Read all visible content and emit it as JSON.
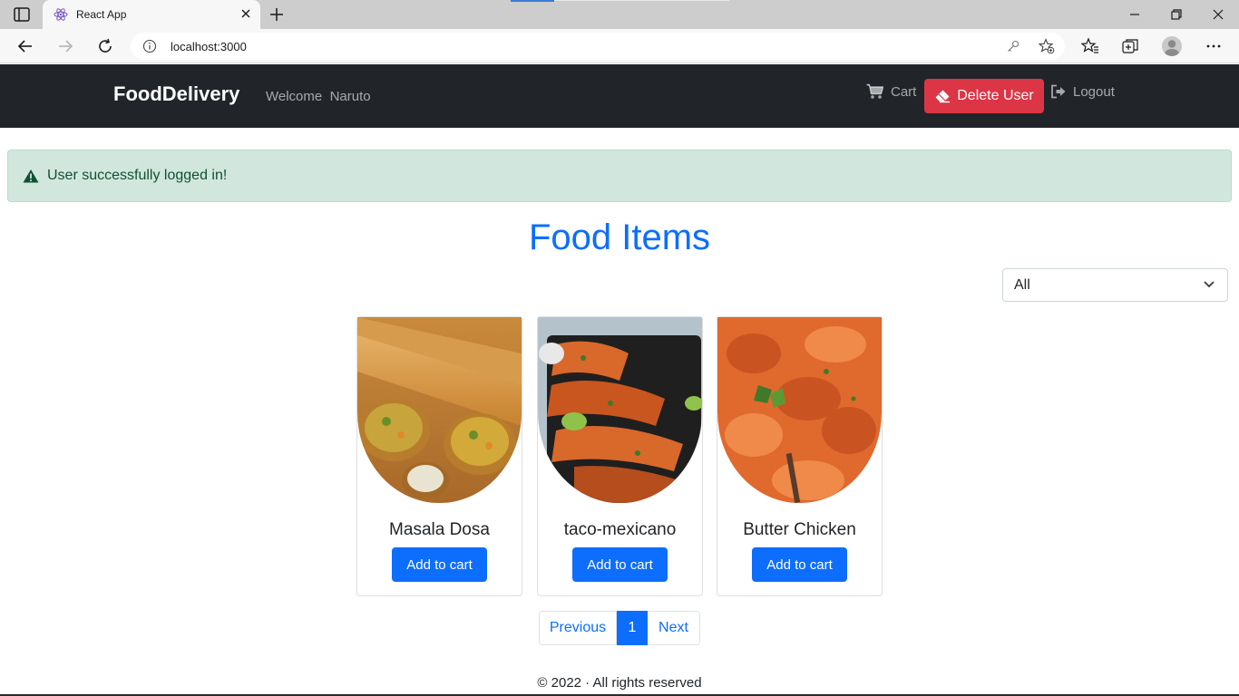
{
  "browser": {
    "tab_title": "React App",
    "url": "localhost:3000"
  },
  "navbar": {
    "brand": "FoodDelivery",
    "welcome": "Welcome  Naruto",
    "cart_label": "Cart",
    "delete_user_label": "Delete User",
    "logout_label": "Logout"
  },
  "alert": {
    "message": "User successfully logged in!"
  },
  "main": {
    "heading": "Food Items",
    "filter_selected": "All",
    "items": [
      {
        "name": "Masala Dosa",
        "button": "Add to cart"
      },
      {
        "name": "taco-mexicano",
        "button": "Add to cart"
      },
      {
        "name": "Butter Chicken",
        "button": "Add to cart"
      }
    ],
    "pagination": {
      "previous": "Previous",
      "current": "1",
      "next": "Next"
    }
  },
  "footer": {
    "text": "© 2022 · All rights reserved"
  },
  "colors": {
    "navbar_bg": "#212529",
    "primary": "#0d6efd",
    "danger": "#dc3545",
    "alert_bg": "#d1e7dd",
    "alert_text": "#0f5132"
  }
}
